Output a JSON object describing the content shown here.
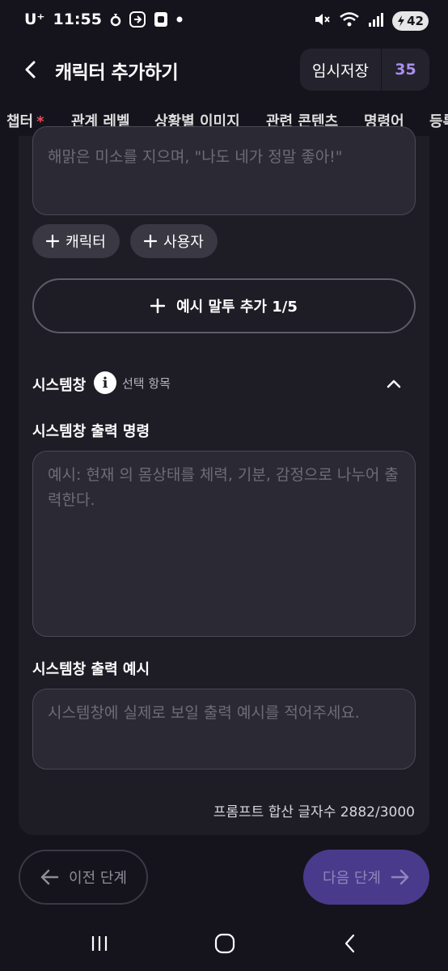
{
  "status_bar": {
    "carrier": "U⁺",
    "time": "11:55",
    "battery": "42",
    "icons": [
      "notification-icon",
      "app-icon",
      "app-icon",
      "dot-icon",
      "mute-icon",
      "wifi-icon",
      "signal-icon",
      "battery-icon"
    ]
  },
  "header": {
    "back_icon": "chevron-left-icon",
    "title": "캐릭터 추가하기",
    "save_label": "임시저장",
    "save_count": "35"
  },
  "tabs": [
    {
      "label": "챕터",
      "required": "*"
    },
    {
      "label": "관계 레벨"
    },
    {
      "label": "상황별 이미지"
    },
    {
      "label": "관련 콘텐츠"
    },
    {
      "label": "명령어"
    },
    {
      "label": "등록"
    }
  ],
  "example_speech": {
    "text": "해맑은 미소를 지으며, \"나도 네가 정말 좋아!\"",
    "add_character_label": "캐릭터",
    "add_user_label": "사용자",
    "add_example_label": "예시 말투 추가 1/5"
  },
  "system_window": {
    "title": "시스템창",
    "optional_label": "선택 항목",
    "output_command_title": "시스템창 출력 명령",
    "output_command_placeholder": "예시: 현재 의 몸상태를 체력, 기분, 감정으로 나누어 출력한다.",
    "output_example_title": "시스템창 출력 예시",
    "output_example_placeholder": "시스템창에 실제로 보일 출력 예시를 적어주세요."
  },
  "prompt_counter": "프롬프트 합산 글자수 2882/3000",
  "footer": {
    "prev_label": "이전 단계",
    "next_label": "다음 단계"
  },
  "colors": {
    "background": "#15141c",
    "card": "#1e1d26",
    "accent": "#a98df0",
    "next_button": "#4a3a8c",
    "required": "#f04a59"
  }
}
